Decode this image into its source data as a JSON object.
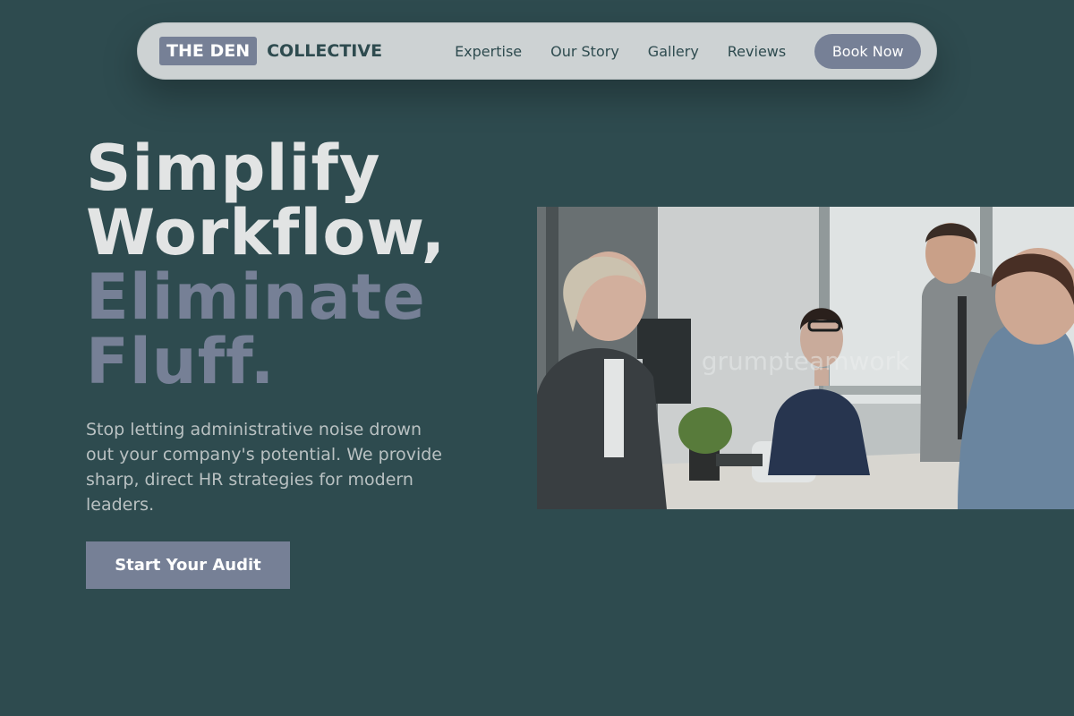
{
  "nav": {
    "brand_box": "THE DEN",
    "brand_text": "COLLECTIVE",
    "links": [
      "Expertise",
      "Our Story",
      "Gallery",
      "Reviews"
    ],
    "cta": "Book Now"
  },
  "hero": {
    "title_line1": "Simplify",
    "title_line2": "Workflow,",
    "title_line3": "Eliminate",
    "title_line4": "Fluff.",
    "description": "Stop letting administrative noise drown out your company's potential. We provide sharp, direct HR strategies for modern leaders.",
    "cta": "Start Your Audit",
    "image_watermark": "grumpteamwork"
  },
  "colors": {
    "background": "#2e4b4f",
    "accent": "#768096",
    "nav_bg": "#cdd2d3",
    "title_light": "#e2e4e4"
  }
}
